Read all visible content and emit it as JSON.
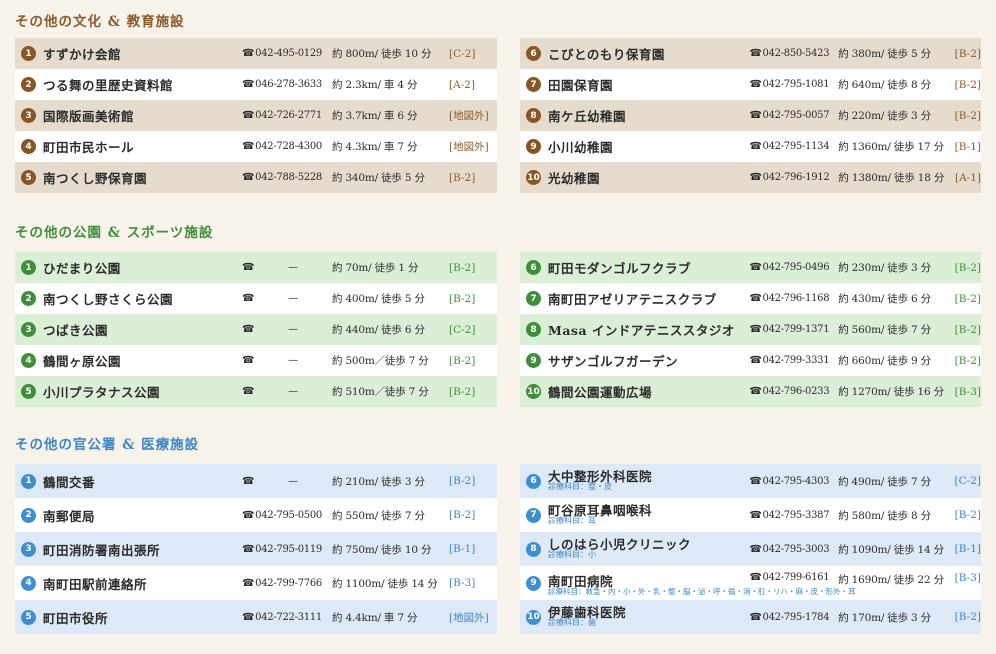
{
  "colors": {
    "culture": "#8a5524",
    "parks": "#3f8f3a",
    "gov": "#3e8fd0"
  },
  "sections": [
    {
      "title": "その他の文化 & 教育施設",
      "left": [
        {
          "num": "1",
          "name": "すずかけ会館",
          "tel": "042-495-0129",
          "dist": "約 800m/ 徒歩 10 分",
          "grid": "[C-2]"
        },
        {
          "num": "2",
          "name": "つる舞の里歴史資料館",
          "tel": "046-278-3633",
          "dist": "約 2.3km/ 車 4 分",
          "grid": "[A-2]"
        },
        {
          "num": "3",
          "name": "国際版画美術館",
          "tel": "042-726-2771",
          "dist": "約 3.7km/ 車 6 分",
          "grid": "[地図外]"
        },
        {
          "num": "4",
          "name": "町田市民ホール",
          "tel": "042-728-4300",
          "dist": "約 4.3km/ 車 7 分",
          "grid": "[地図外]"
        },
        {
          "num": "5",
          "name": "南つくし野保育園",
          "tel": "042-788-5228",
          "dist": "約 340m/ 徒歩 5 分",
          "grid": "[B-2]"
        }
      ],
      "right": [
        {
          "num": "6",
          "name": "こびとのもり保育園",
          "tel": "042-850-5423",
          "dist": "約 380m/ 徒歩 5 分",
          "grid": "[B-2]"
        },
        {
          "num": "7",
          "name": "田園保育園",
          "tel": "042-795-1081",
          "dist": "約 640m/ 徒歩 8 分",
          "grid": "[B-2]"
        },
        {
          "num": "8",
          "name": "南ケ丘幼稚園",
          "tel": "042-795-0057",
          "dist": "約 220m/ 徒歩 3 分",
          "grid": "[B-2]"
        },
        {
          "num": "9",
          "name": "小川幼稚園",
          "tel": "042-795-1134",
          "dist": "約 1360m/ 徒歩 17 分",
          "grid": "[B-1]"
        },
        {
          "num": "10",
          "name": "光幼稚園",
          "tel": "042-796-1912",
          "dist": "約 1380m/ 徒歩 18 分",
          "grid": "[A-1]"
        }
      ]
    },
    {
      "title": "その他の公園 & スポーツ施設",
      "left": [
        {
          "num": "1",
          "name": "ひだまり公園",
          "tel": "—",
          "dist": "約 70m/ 徒歩 1 分",
          "grid": "[B-2]"
        },
        {
          "num": "2",
          "name": "南つくし野さくら公園",
          "tel": "—",
          "dist": "約 400m/ 徒歩 5 分",
          "grid": "[B-2]"
        },
        {
          "num": "3",
          "name": "つばき公園",
          "tel": "—",
          "dist": "約 440m/ 徒歩 6 分",
          "grid": "[C-2]"
        },
        {
          "num": "4",
          "name": "鶴間ヶ原公園",
          "tel": "—",
          "dist": "約 500m／徒歩 7 分",
          "grid": "[B-2]"
        },
        {
          "num": "5",
          "name": "小川プラタナス公園",
          "tel": "—",
          "dist": "約 510m／徒歩 7 分",
          "grid": "[B-2]"
        }
      ],
      "right": [
        {
          "num": "6",
          "name": "町田モダンゴルフクラブ",
          "tel": "042-795-0496",
          "dist": "約 230m/ 徒歩 3 分",
          "grid": "[B-2]"
        },
        {
          "num": "7",
          "name": "南町田アゼリアテニスクラブ",
          "tel": "042-796-1168",
          "dist": "約 430m/ 徒歩 6 分",
          "grid": "[B-2]"
        },
        {
          "num": "8",
          "name": "Masa インドアテニススタジオ",
          "tel": "042-799-1371",
          "dist": "約 560m/ 徒歩 7 分",
          "grid": "[B-2]"
        },
        {
          "num": "9",
          "name": "サザンゴルフガーデン",
          "tel": "042-799-3331",
          "dist": "約 660m/ 徒歩 9 分",
          "grid": "[B-2]"
        },
        {
          "num": "10",
          "name": "鶴間公園運動広場",
          "tel": "042-796-0233",
          "dist": "約 1270m/ 徒歩 16 分",
          "grid": "[B-3]"
        }
      ]
    },
    {
      "title": "その他の官公署 & 医療施設",
      "left": [
        {
          "num": "1",
          "name": "鶴間交番",
          "tel": "—",
          "dist": "約 210m/ 徒歩 3 分",
          "grid": "[B-2]"
        },
        {
          "num": "2",
          "name": "南郵便局",
          "tel": "042-795-0500",
          "dist": "約 550m/ 徒歩 7 分",
          "grid": "[B-2]"
        },
        {
          "num": "3",
          "name": "町田消防署南出張所",
          "tel": "042-795-0119",
          "dist": "約 750m/ 徒歩 10 分",
          "grid": "[B-1]"
        },
        {
          "num": "4",
          "name": "南町田駅前連絡所",
          "tel": "042-799-7766",
          "dist": "約 1100m/ 徒歩 14 分",
          "grid": "[B-3]"
        },
        {
          "num": "5",
          "name": "町田市役所",
          "tel": "042-722-3111",
          "dist": "約 4.4km/ 車 7 分",
          "grid": "[地図外]"
        }
      ],
      "right": [
        {
          "num": "6",
          "name": "大中整形外科医院",
          "sub": "診療科目：整・皮",
          "tel": "042-795-4303",
          "dist": "約 490m/ 徒歩 7 分",
          "grid": "[C-2]"
        },
        {
          "num": "7",
          "name": "町谷原耳鼻咽喉科",
          "sub": "診療科目：耳",
          "tel": "042-795-3387",
          "dist": "約 580m/ 徒歩 8 分",
          "grid": "[B-2]"
        },
        {
          "num": "8",
          "name": "しのはら小児クリニック",
          "sub": "診療科目：小",
          "tel": "042-795-3003",
          "dist": "約 1090m/ 徒歩 14 分",
          "grid": "[B-1]"
        },
        {
          "num": "9",
          "name": "南町田病院",
          "sub": "診療科目：救急・内・小・外・乳・整・脳・泌・呼・循・消・肛・リハ・麻・皮・形外・耳",
          "tel": "042-799-6161",
          "dist": "約 1690m/ 徒歩 22 分",
          "grid": "[B-3]"
        },
        {
          "num": "10",
          "name": "伊藤歯科医院",
          "sub": "診療科目：歯",
          "tel": "042-795-1784",
          "dist": "約 170m/ 徒歩 3 分",
          "grid": "[B-2]"
        }
      ]
    }
  ]
}
